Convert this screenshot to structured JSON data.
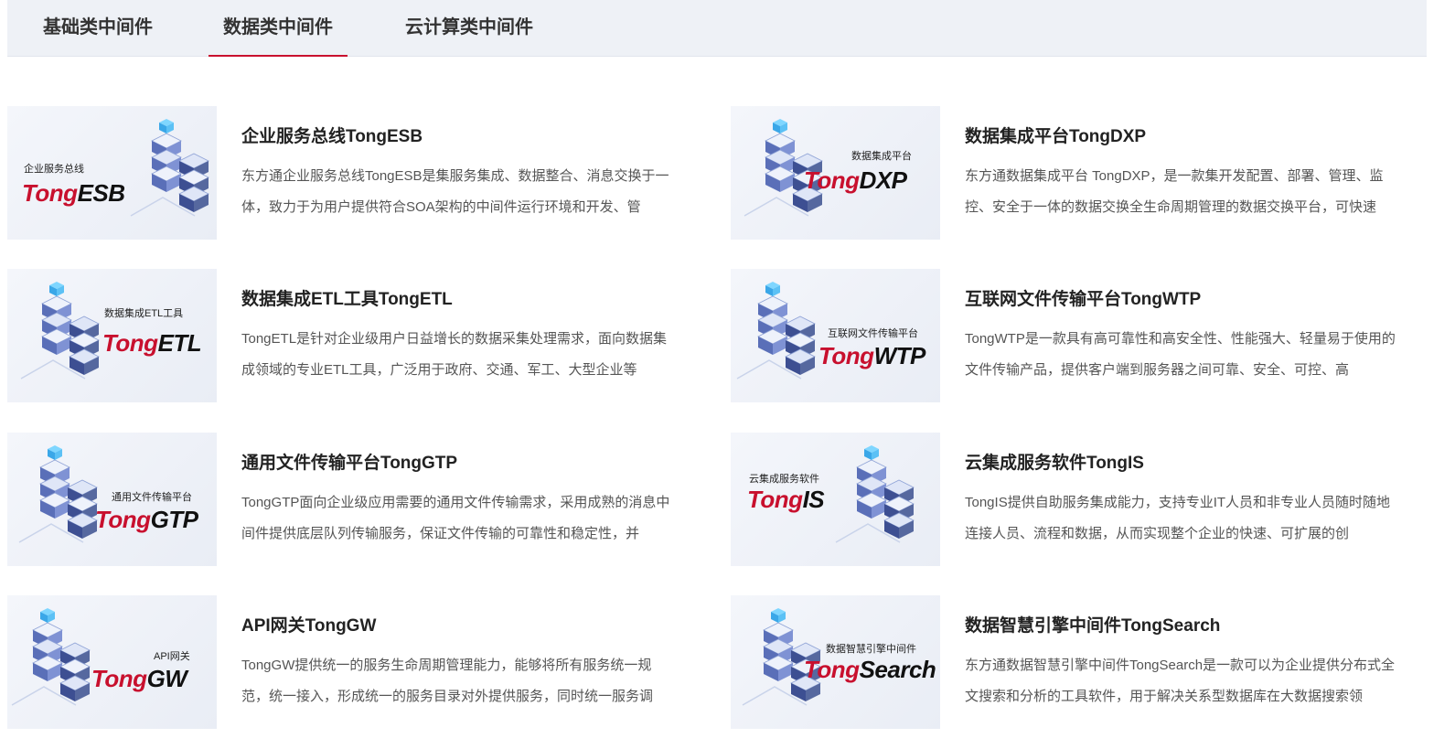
{
  "tabs": [
    {
      "label": "基础类中间件"
    },
    {
      "label": "数据类中间件"
    },
    {
      "label": "云计算类中间件"
    }
  ],
  "active_tab": "数据类中间件",
  "accent_color": "#c8102e",
  "products": [
    {
      "title": "企业服务总线TongESB",
      "image_label": "企业服务总线",
      "brand_tong": "Tong",
      "brand_suffix": "ESB",
      "desc": "东方通企业服务总线TongESB是集服务集成、数据整合、消息交换于一体，致力于为用户提供符合SOA架构的中间件运行环境和开发、管"
    },
    {
      "title": "数据集成平台TongDXP",
      "image_label": "数据集成平台",
      "brand_tong": "Tong",
      "brand_suffix": "DXP",
      "desc": "东方通数据集成平台 TongDXP，是一款集开发配置、部署、管理、监控、安全于一体的数据交换全生命周期管理的数据交换平台，可快速"
    },
    {
      "title": "数据集成ETL工具TongETL",
      "image_label": "数据集成ETL工具",
      "brand_tong": "Tong",
      "brand_suffix": "ETL",
      "desc": "TongETL是针对企业级用户日益增长的数据采集处理需求，面向数据集成领域的专业ETL工具，广泛用于政府、交通、军工、大型企业等"
    },
    {
      "title": "互联网文件传输平台TongWTP",
      "image_label": "互联网文件传输平台",
      "brand_tong": "Tong",
      "brand_suffix": "WTP",
      "desc": "TongWTP是一款具有高可靠性和高安全性、性能强大、轻量易于使用的文件传输产品，提供客户端到服务器之间可靠、安全、可控、高"
    },
    {
      "title": "通用文件传输平台TongGTP",
      "image_label": "通用文件传输平台",
      "brand_tong": "Tong",
      "brand_suffix": "GTP",
      "desc": "TongGTP面向企业级应用需要的通用文件传输需求，采用成熟的消息中间件提供底层队列传输服务，保证文件传输的可靠性和稳定性，并"
    },
    {
      "title": "云集成服务软件TongIS",
      "image_label": "云集成服务软件",
      "brand_tong": "Tong",
      "brand_suffix": "IS",
      "desc": "TongIS提供自助服务集成能力，支持专业IT人员和非专业人员随时随地连接人员、流程和数据，从而实现整个企业的快速、可扩展的创"
    },
    {
      "title": "API网关TongGW",
      "image_label": "API网关",
      "brand_tong": "Tong",
      "brand_suffix": "GW",
      "desc": "TongGW提供统一的服务生命周期管理能力，能够将所有服务统一规范，统一接入，形成统一的服务目录对外提供服务，同时统一服务调"
    },
    {
      "title": "数据智慧引擎中间件TongSearch",
      "image_label": "数据智慧引擎中间件",
      "brand_tong": "Tong",
      "brand_suffix": "Search",
      "desc": "东方通数据智慧引擎中间件TongSearch是一款可以为企业提供分布式全文搜索和分析的工具软件，用于解决关系型数据库在大数据搜索领"
    }
  ]
}
